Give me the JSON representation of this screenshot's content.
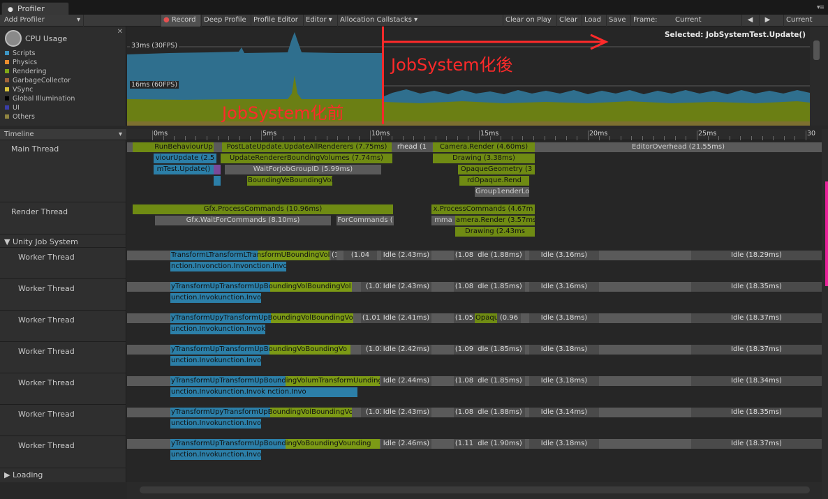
{
  "window": {
    "tab_title": "Profiler",
    "menu_icon": "context-menu-icon"
  },
  "toolbar": {
    "add_profiler": "Add Profiler",
    "record": "Record",
    "deep_profile": "Deep Profile",
    "profile_editor": "Profile Editor",
    "editor": "Editor",
    "allocation_callstacks": "Allocation Callstacks",
    "clear_on_play": "Clear on Play",
    "clear": "Clear",
    "load": "Load",
    "save": "Save",
    "frame_label": "Frame:",
    "frame_value": "Current",
    "current": "Current"
  },
  "cpu_panel": {
    "title": "CPU Usage",
    "legend": [
      {
        "label": "Scripts",
        "color": "#3d94c2"
      },
      {
        "label": "Physics",
        "color": "#ea8c2f"
      },
      {
        "label": "Rendering",
        "color": "#80a818"
      },
      {
        "label": "GarbageCollector",
        "color": "#a1643a"
      },
      {
        "label": "VSync",
        "color": "#d8c33a"
      },
      {
        "label": "Global Illumination",
        "color": "#000000"
      },
      {
        "label": "UI",
        "color": "#3a3ea8"
      },
      {
        "label": "Others",
        "color": "#8f8440"
      }
    ],
    "line_33": "33ms (30FPS)",
    "line_16": "16ms (60FPS)",
    "selected": "Selected: JobSystemTest.Update()"
  },
  "annotations": {
    "before": "JobSystem化前",
    "after": "JobSystem化後",
    "red_color": "#ff2a2a"
  },
  "timeline": {
    "header": "Timeline",
    "ruler": [
      "0ms",
      "5ms",
      "10ms",
      "15ms",
      "20ms",
      "25ms",
      "30"
    ],
    "main_thread": "Main Thread",
    "render_thread": "Render Thread",
    "job_system": "Unity Job System",
    "worker_label": "Worker Thread",
    "loading": "Loading",
    "main_blocks": {
      "row1": [
        "RunBehaviourUp",
        "PostLateUpdate.UpdateAllRenderers (7.75ms)",
        "rhead (1",
        "Camera.Render (4.60ms)",
        "EditorOverhead (21.55ms)"
      ],
      "row2": [
        "viourUpdate (2.5",
        "UpdateRendererBoundingVolumes (7.74ms)",
        "Drawing (3.38ms)"
      ],
      "row3": [
        "mTest.Update()",
        "WaitForJobGroupID (5.99ms)",
        "OpaqueGeometry (3"
      ],
      "row4": [
        "BoundingVeBoundingVol",
        "rdOpaque.Rend"
      ],
      "row5": [
        "Group1enderLo"
      ]
    },
    "render_blocks": {
      "row1": [
        "Gfx.ProcessCommands (10.96ms)",
        "x.ProcessCommands (4.67m"
      ],
      "row2": [
        "Gfx.WaitForCommands (8.10ms)",
        "ForCommands (",
        "mma",
        "amera.Render (3.57ms"
      ],
      "row3": [
        "Drawing (2.43ms"
      ]
    },
    "workers": [
      {
        "top": [
          "TransformLTransformLTransformUBoundingVol",
          "(1.04",
          "Idle (2.43ms)",
          "(1.08",
          "dle (1.88ms)",
          "Idle (3.16ms)",
          "Idle (18.29ms)"
        ],
        "bottom": "nction.Invonction.Invonction.Invo"
      },
      {
        "top": [
          "yTransformUpTransformUpBoundingVolBoundingVol",
          "(1.03",
          "Idle (2.43ms)",
          "(1.08",
          "dle (1.85ms)",
          "Idle (3.16ms)",
          "Idle (18.35ms)"
        ],
        "bottom": "unction.Invokunction.Invok"
      },
      {
        "top": [
          "yTransformUpyTransformUpBoundingVolBoundingVol",
          "(1.01",
          "Idle (2.41ms)",
          "(1.05",
          "Opaque",
          "(0.96",
          "Idle (3.18ms)",
          "Idle (18.37ms)"
        ],
        "bottom": "unction.Invokunction.Invok"
      },
      {
        "top": [
          "yTransformUpTransformUpBoundingVoBoundingVo",
          "(1.03",
          "Idle (2.42ms)",
          "(1.09",
          "dle (1.85ms)",
          "Idle (3.18ms)",
          "Idle (18.37ms)"
        ],
        "bottom": "unction.Invokunction.Invok"
      },
      {
        "top": [
          "yTransformUpTransformUpBoundingVolumTransformUunding",
          "Idle (2.44ms)",
          "(1.08",
          "dle (1.85ms)",
          "Idle (3.18ms)",
          "Idle (18.34ms)"
        ],
        "bottom": "unction.Invokunction.Invok  nction.Invo"
      },
      {
        "top": [
          "yTransformUpyTransformUpBoundingVolBoundingVol",
          "(1.03",
          "Idle (2.43ms)",
          "(1.08",
          "dle (1.88ms)",
          "Idle (3.14ms)",
          "Idle (18.35ms)"
        ],
        "bottom": "unction.Invokunction.Invok"
      },
      {
        "top": [
          "yTransformUpTransformUpBoundingVoBoundingVounding",
          "Idle (2.46ms)",
          "(1.11",
          "dle (1.90ms)",
          "Idle (3.18ms)",
          "Idle (18.37ms)"
        ],
        "bottom": "unction.Invokunction.Invok"
      }
    ]
  }
}
